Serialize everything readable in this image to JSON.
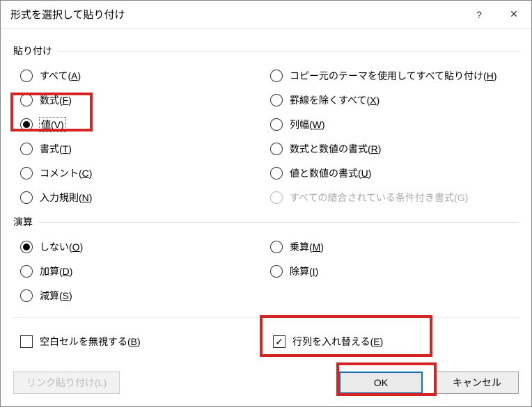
{
  "title": "形式を選択して貼り付け",
  "help_glyph": "?",
  "close_glyph": "✕",
  "groups": {
    "paste": "貼り付け",
    "operation": "演算"
  },
  "paste": {
    "left": [
      {
        "label": "すべて",
        "accel": "A",
        "selected": false
      },
      {
        "label": "数式",
        "accel": "F",
        "selected": false
      },
      {
        "label": "値",
        "accel": "V",
        "selected": true
      },
      {
        "label": "書式",
        "accel": "T",
        "selected": false
      },
      {
        "label": "コメント",
        "accel": "C",
        "selected": false
      },
      {
        "label": "入力規則",
        "accel": "N",
        "selected": false
      }
    ],
    "right": [
      {
        "label": "コピー元のテーマを使用してすべて貼り付け",
        "accel": "H",
        "selected": false
      },
      {
        "label": "罫線を除くすべて",
        "accel": "X",
        "selected": false
      },
      {
        "label": "列幅",
        "accel": "W",
        "selected": false
      },
      {
        "label": "数式と数値の書式",
        "accel": "R",
        "selected": false
      },
      {
        "label": "値と数値の書式",
        "accel": "U",
        "selected": false
      },
      {
        "label": "すべての結合されている条件付き書式",
        "accel": "G",
        "selected": false,
        "disabled": true
      }
    ]
  },
  "operation": {
    "left": [
      {
        "label": "しない",
        "accel": "O",
        "selected": true
      },
      {
        "label": "加算",
        "accel": "D",
        "selected": false
      },
      {
        "label": "減算",
        "accel": "S",
        "selected": false
      }
    ],
    "right": [
      {
        "label": "乗算",
        "accel": "M",
        "selected": false
      },
      {
        "label": "除算",
        "accel": "I",
        "selected": false
      }
    ]
  },
  "checks": {
    "skip_blanks": {
      "label": "空白セルを無視する",
      "accel": "B",
      "checked": false
    },
    "transpose": {
      "label": "行列を入れ替える",
      "accel": "E",
      "checked": true
    }
  },
  "buttons": {
    "paste_link": {
      "label": "リンク貼り付け",
      "accel": "L",
      "disabled": true
    },
    "ok": "OK",
    "cancel": "キャンセル"
  }
}
